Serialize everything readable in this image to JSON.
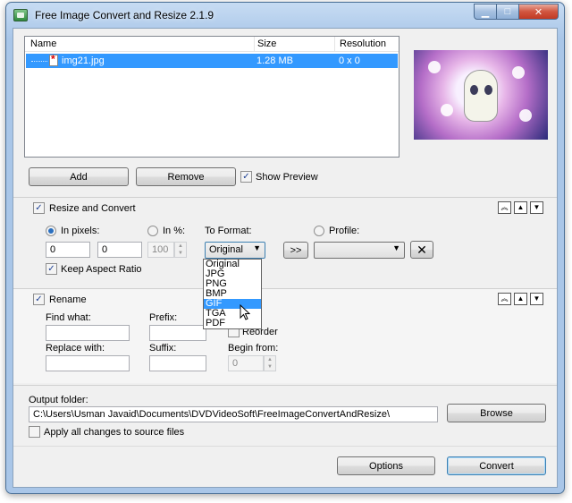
{
  "window": {
    "title": "Free Image Convert and Resize 2.1.9"
  },
  "file_list": {
    "columns": [
      "Name",
      "Size",
      "Resolution"
    ],
    "rows": [
      {
        "name": "img21.jpg",
        "size": "1.28 MB",
        "resolution": "0 x 0"
      }
    ]
  },
  "actions": {
    "add": "Add",
    "remove": "Remove",
    "show_preview": "Show Preview"
  },
  "resize": {
    "title": "Resize and Convert",
    "in_pixels": "In pixels:",
    "width": "0",
    "height": "0",
    "in_percent": "In %:",
    "percent": "100",
    "keep_aspect": "Keep Aspect Ratio",
    "to_format": "To Format:",
    "format_selected": "Original",
    "format_options": [
      "Original",
      "JPG",
      "PNG",
      "BMP",
      "GIF",
      "TGA",
      "PDF"
    ],
    "format_highlighted": "GIF",
    "apply_button": ">>",
    "profile": "Profile:",
    "profile_value": "",
    "delete_button": "✕"
  },
  "rename": {
    "title": "Rename",
    "find_what": "Find what:",
    "prefix": "Prefix:",
    "reorder": "Reorder",
    "replace_with": "Replace with:",
    "suffix": "Suffix:",
    "begin_from": "Begin from:",
    "begin_value": "0"
  },
  "output": {
    "label": "Output folder:",
    "path": "C:\\Users\\Usman Javaid\\Documents\\DVDVideoSoft\\FreeImageConvertAndResize\\",
    "browse": "Browse",
    "apply_to_source": "Apply all changes to source files"
  },
  "footer": {
    "options": "Options",
    "convert": "Convert"
  },
  "colors": {
    "selection": "#3399ff",
    "titlebar": "#a9c6e8",
    "close": "#c23a24"
  }
}
